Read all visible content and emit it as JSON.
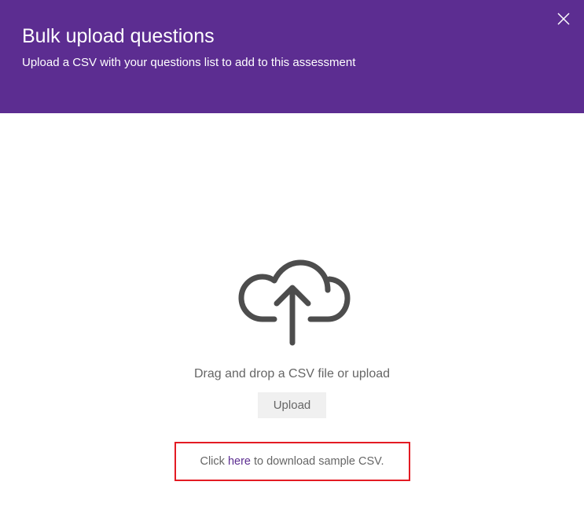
{
  "header": {
    "title": "Bulk upload questions",
    "subtitle": "Upload a CSV with your questions list to add to this assessment"
  },
  "main": {
    "drag_text": "Drag and drop a CSV file or upload",
    "upload_button": "Upload",
    "download_prefix": "Click ",
    "download_link": "here",
    "download_suffix": " to download sample CSV."
  },
  "colors": {
    "primary": "#5c2d91",
    "highlight_border": "#e31b23"
  }
}
